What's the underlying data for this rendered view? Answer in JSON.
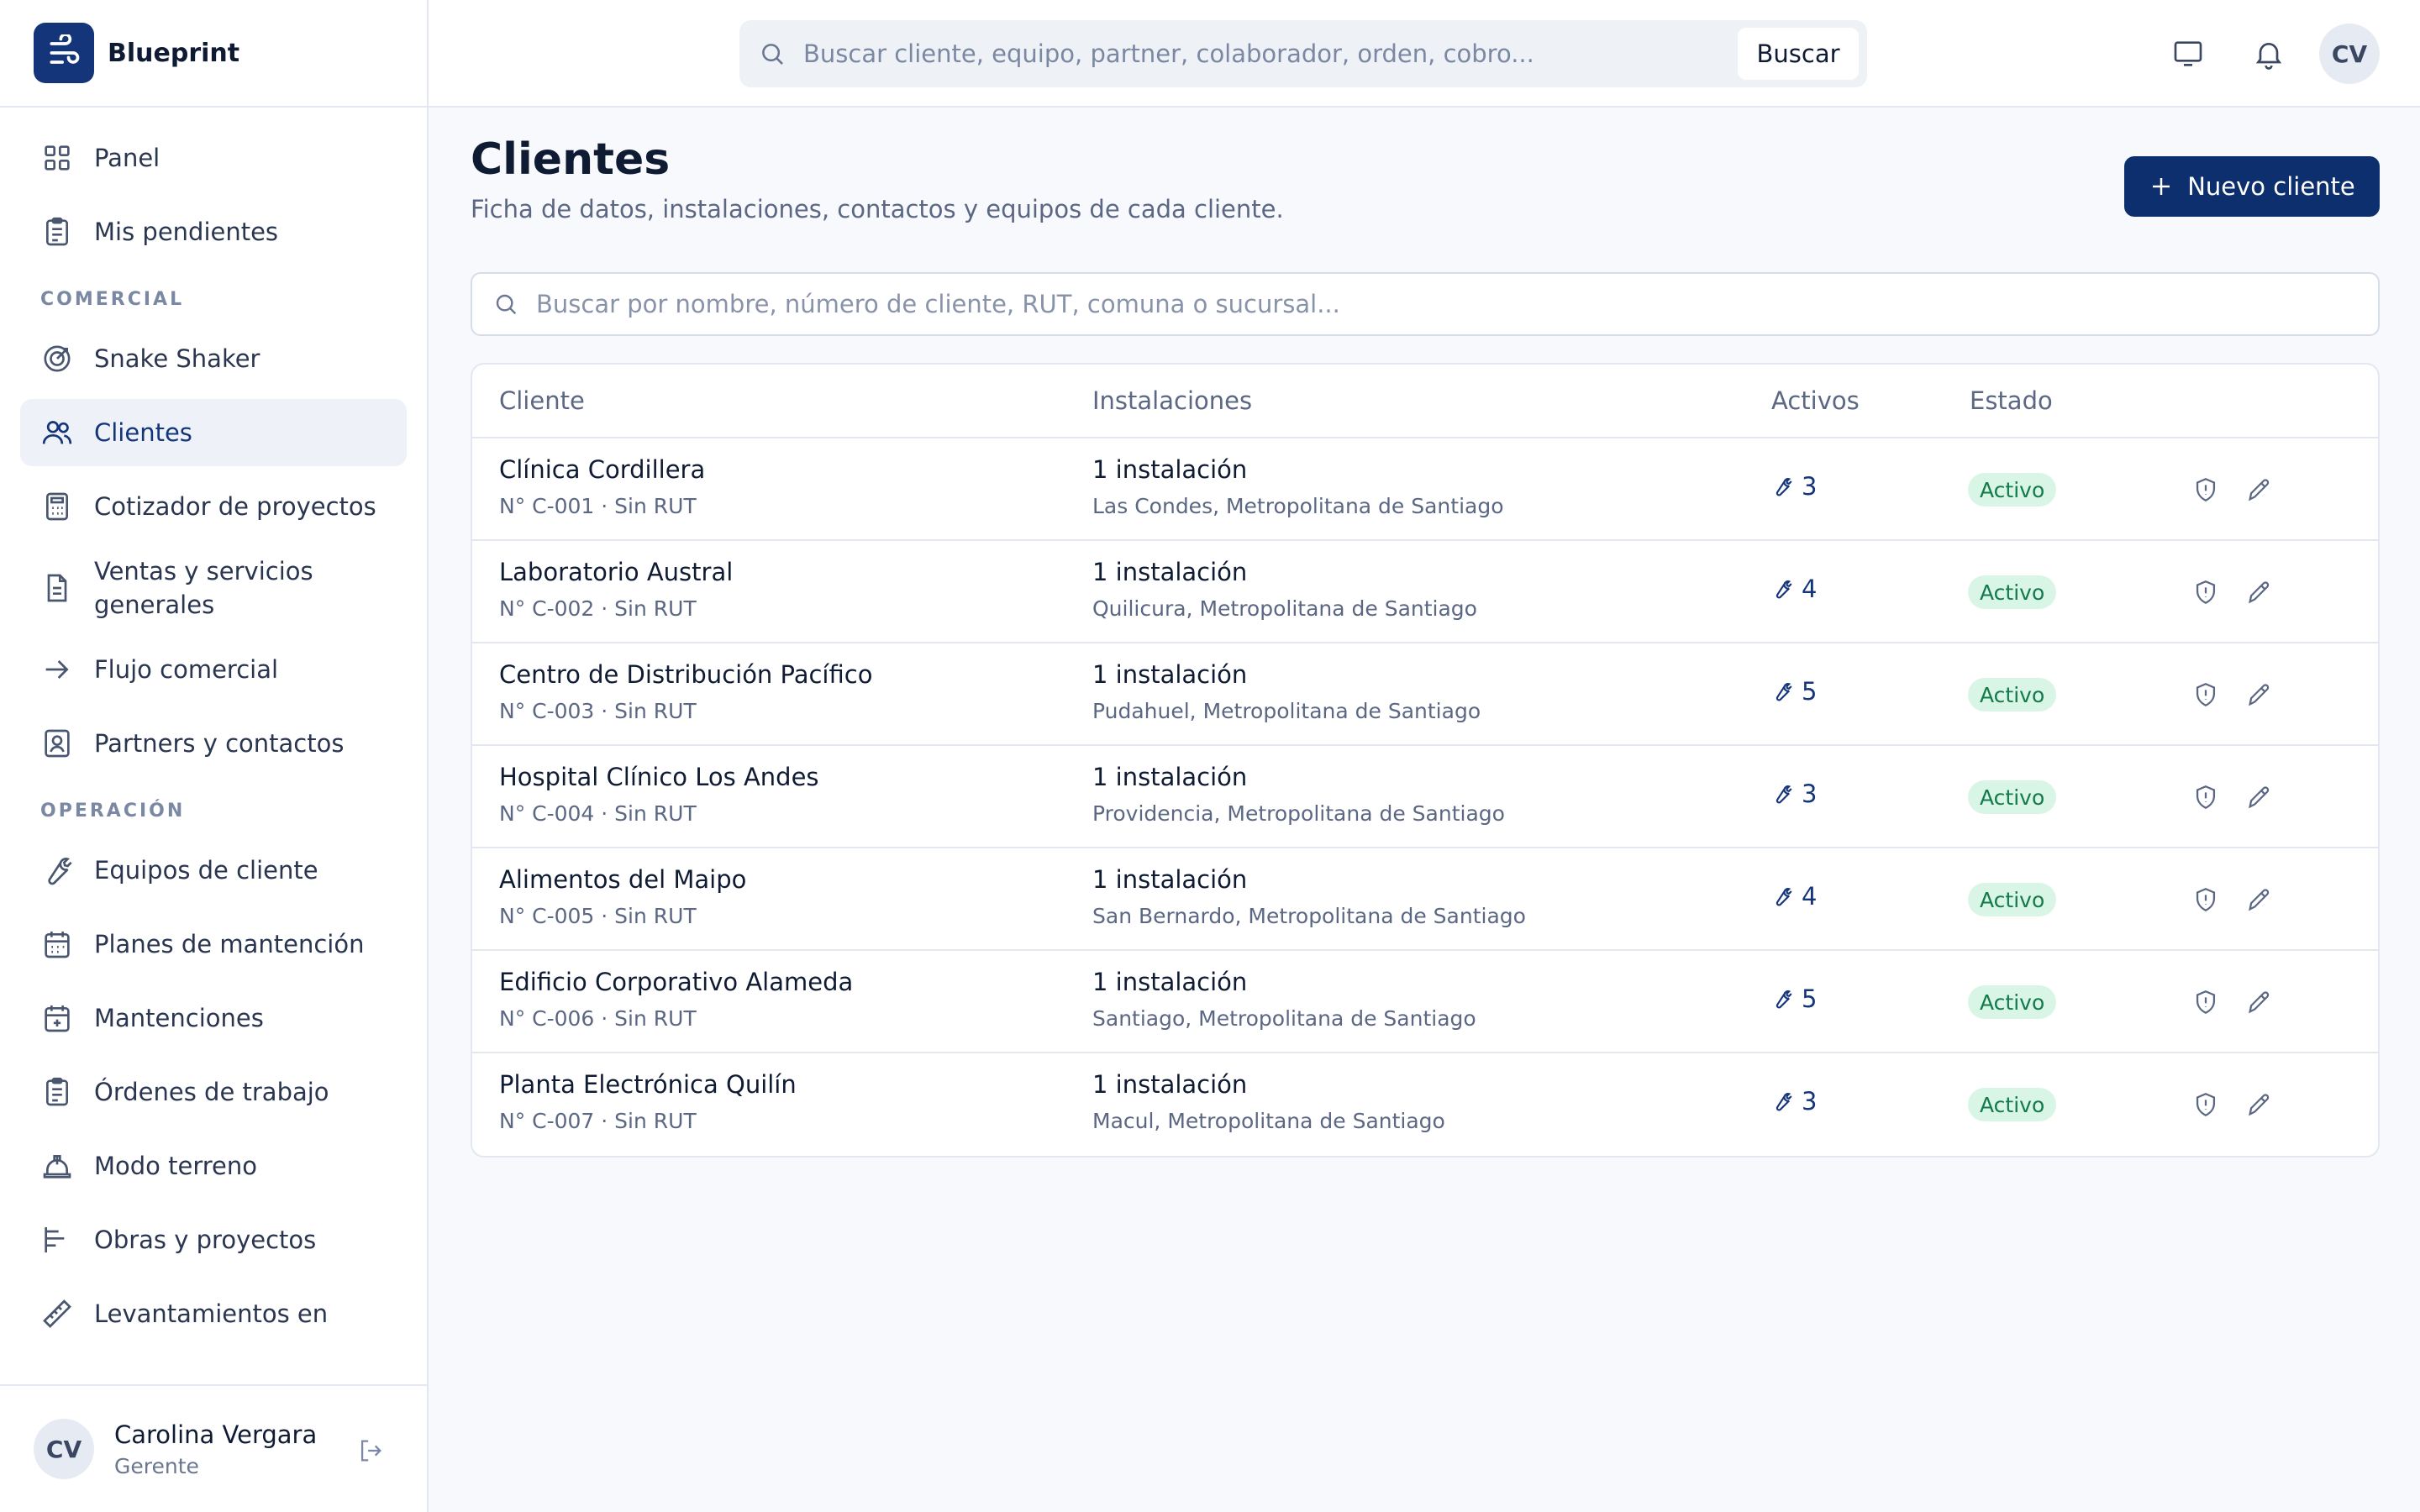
{
  "brand": {
    "name": "Blueprint"
  },
  "topbar": {
    "search_placeholder": "Buscar cliente, equipo, partner, colaborador, orden, cobro...",
    "search_button": "Buscar",
    "avatar_initials": "CV"
  },
  "sidebar": {
    "items": [
      {
        "label": "Panel",
        "icon": "grid-icon"
      },
      {
        "label": "Mis pendientes",
        "icon": "clipboard-icon"
      },
      {
        "section": "COMERCIAL"
      },
      {
        "label": "Snake Shaker",
        "icon": "target-icon"
      },
      {
        "label": "Clientes",
        "icon": "users-icon",
        "active": true
      },
      {
        "label": "Cotizador de proyectos",
        "icon": "calculator-icon"
      },
      {
        "label": "Ventas y servicios generales",
        "icon": "document-icon"
      },
      {
        "label": "Flujo comercial",
        "icon": "arrow-right-icon"
      },
      {
        "label": "Partners y contactos",
        "icon": "contact-icon"
      },
      {
        "section": "OPERACIÓN"
      },
      {
        "label": "Equipos de cliente",
        "icon": "wrench-icon"
      },
      {
        "label": "Planes de mantención",
        "icon": "calendar-icon"
      },
      {
        "label": "Mantenciones",
        "icon": "calendar-plus-icon"
      },
      {
        "label": "Órdenes de trabajo",
        "icon": "clipboard-icon"
      },
      {
        "label": "Modo terreno",
        "icon": "hard-hat-icon"
      },
      {
        "label": "Obras y proyectos",
        "icon": "gantt-icon"
      },
      {
        "label": "Levantamientos en",
        "icon": "ruler-icon"
      }
    ]
  },
  "user": {
    "initials": "CV",
    "name": "Carolina Vergara",
    "role": "Gerente"
  },
  "page": {
    "title": "Clientes",
    "subtitle": "Ficha de datos, instalaciones, contactos y equipos de cada cliente.",
    "new_button": "Nuevo cliente",
    "search_placeholder": "Buscar por nombre, número de cliente, RUT, comuna o sucursal..."
  },
  "table": {
    "headers": {
      "cliente": "Cliente",
      "instalaciones": "Instalaciones",
      "activos": "Activos",
      "estado": "Estado"
    },
    "rows": [
      {
        "name": "Clínica Cordillera",
        "sub": "N° C-001 · Sin RUT",
        "inst": "1 instalación",
        "loc": "Las Condes, Metropolitana de Santiago",
        "assets": "3",
        "status": "Activo"
      },
      {
        "name": "Laboratorio Austral",
        "sub": "N° C-002 · Sin RUT",
        "inst": "1 instalación",
        "loc": "Quilicura, Metropolitana de Santiago",
        "assets": "4",
        "status": "Activo"
      },
      {
        "name": "Centro de Distribución Pacífico",
        "sub": "N° C-003 · Sin RUT",
        "inst": "1 instalación",
        "loc": "Pudahuel, Metropolitana de Santiago",
        "assets": "5",
        "status": "Activo"
      },
      {
        "name": "Hospital Clínico Los Andes",
        "sub": "N° C-004 · Sin RUT",
        "inst": "1 instalación",
        "loc": "Providencia, Metropolitana de Santiago",
        "assets": "3",
        "status": "Activo"
      },
      {
        "name": "Alimentos del Maipo",
        "sub": "N° C-005 · Sin RUT",
        "inst": "1 instalación",
        "loc": "San Bernardo, Metropolitana de Santiago",
        "assets": "4",
        "status": "Activo"
      },
      {
        "name": "Edificio Corporativo Alameda",
        "sub": "N° C-006 · Sin RUT",
        "inst": "1 instalación",
        "loc": "Santiago, Metropolitana de Santiago",
        "assets": "5",
        "status": "Activo"
      },
      {
        "name": "Planta Electrónica Quilín",
        "sub": "N° C-007 · Sin RUT",
        "inst": "1 instalación",
        "loc": "Macul, Metropolitana de Santiago",
        "assets": "3",
        "status": "Activo"
      }
    ]
  },
  "colors": {
    "accent": "#0e2f6e",
    "active_bg": "#eef2f8",
    "badge_bg": "#d9f5e6",
    "badge_text": "#137a4a"
  }
}
